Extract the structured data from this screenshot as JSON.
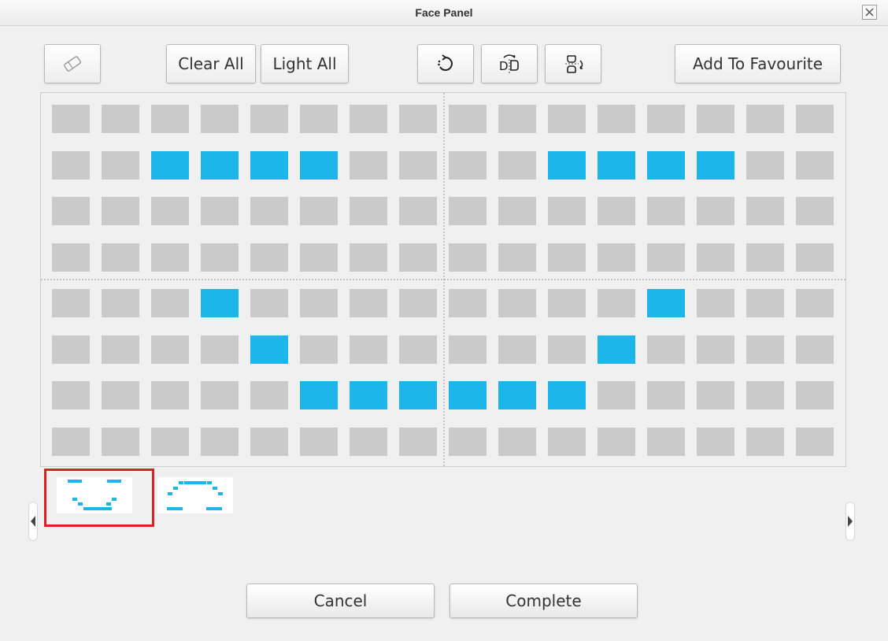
{
  "window": {
    "title": "Face Panel",
    "close_icon": "close-icon"
  },
  "toolbar": {
    "eraser_icon": "eraser-icon",
    "clear_all_label": "Clear All",
    "light_all_label": "Light All",
    "rotate_icon": "rotate-icon",
    "flip_horizontal_icon": "flip-horizontal-icon",
    "flip_vertical_icon": "flip-vertical-icon",
    "add_favourite_label": "Add To Favourite"
  },
  "matrix": {
    "rows": 8,
    "cols": 16,
    "off_color": "#cacaca",
    "on_color": "#1db6ea",
    "lit": [
      [
        1,
        2
      ],
      [
        1,
        3
      ],
      [
        1,
        4
      ],
      [
        1,
        5
      ],
      [
        1,
        10
      ],
      [
        1,
        11
      ],
      [
        1,
        12
      ],
      [
        1,
        13
      ],
      [
        4,
        3
      ],
      [
        4,
        12
      ],
      [
        5,
        4
      ],
      [
        5,
        11
      ],
      [
        6,
        5
      ],
      [
        6,
        6
      ],
      [
        6,
        7
      ],
      [
        6,
        8
      ],
      [
        6,
        9
      ],
      [
        6,
        10
      ]
    ]
  },
  "favourites": {
    "selected_index": 0,
    "items": [
      "smile-face-thumbnail",
      "frown-face-thumbnail"
    ],
    "prev_icon": "left-arrow-icon",
    "next_icon": "right-arrow-icon"
  },
  "footer": {
    "cancel_label": "Cancel",
    "complete_label": "Complete"
  },
  "colors": {
    "accent": "#1db6ea",
    "selection_border": "#e02020"
  }
}
